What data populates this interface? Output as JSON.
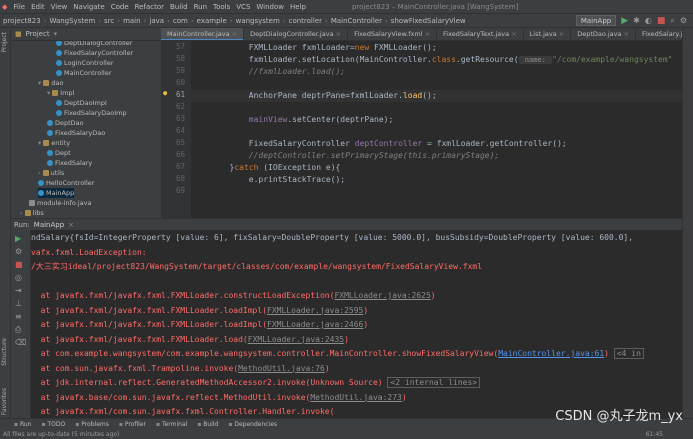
{
  "menubar": {
    "items": [
      "File",
      "Edit",
      "View",
      "Navigate",
      "Code",
      "Refactor",
      "Build",
      "Run",
      "Tools",
      "VCS",
      "Window",
      "Help"
    ],
    "title": "project823 – MainController.java [WangSystem]"
  },
  "navbar": {
    "crumbs": [
      "project823",
      "WangSystem",
      "src",
      "main",
      "java",
      "com",
      "example",
      "wangsystem",
      "controller",
      "MainController",
      "showFixedSalaryView"
    ],
    "run_config": "MainApp"
  },
  "left_strip": {
    "project": "Project",
    "structure": "Structure",
    "favorites": "Favorites"
  },
  "project_panel": {
    "title": "Project"
  },
  "tree": [
    {
      "label": "DeptDialogController",
      "icon": "class",
      "depth": 3
    },
    {
      "label": "FixedSalaryController",
      "icon": "class",
      "depth": 3
    },
    {
      "label": "LoginController",
      "icon": "class",
      "depth": 3
    },
    {
      "label": "MainController",
      "icon": "class",
      "depth": 3
    },
    {
      "label": "dao",
      "icon": "folder",
      "depth": 1,
      "expanded": true
    },
    {
      "label": "impl",
      "icon": "folder",
      "depth": 2,
      "expanded": true
    },
    {
      "label": "DeptDaoImpl",
      "icon": "class",
      "depth": 3
    },
    {
      "label": "FixedSalaryDaoImp",
      "icon": "class",
      "depth": 3
    },
    {
      "label": "DeptDao",
      "icon": "class",
      "depth": 2
    },
    {
      "label": "FixedSalaryDao",
      "icon": "class",
      "depth": 2
    },
    {
      "label": "entity",
      "icon": "folder",
      "depth": 1,
      "expanded": true
    },
    {
      "label": "Dept",
      "icon": "class",
      "depth": 2
    },
    {
      "label": "FixedSalary",
      "icon": "class",
      "depth": 2
    },
    {
      "label": "utils",
      "icon": "folder",
      "depth": 1,
      "expanded": false
    },
    {
      "label": "HelloController",
      "icon": "class",
      "depth": 1
    },
    {
      "label": "MainApp",
      "icon": "class",
      "depth": 1
    },
    {
      "label": "module-info.java",
      "icon": "java",
      "depth": 0
    },
    {
      "label": "libs",
      "icon": "folder",
      "depth": -1,
      "expanded": false
    }
  ],
  "tabs": [
    "MainController.java",
    "DeptDialogController.java",
    "FixedSalaryView.fxml",
    "FixedSalaryText.java",
    "List.java",
    "DeptDao.java",
    "FixedSalary.java"
  ],
  "gutter": [
    "57",
    "58",
    "59",
    "60",
    "61",
    "62",
    "63",
    "64",
    "65",
    "66",
    "67",
    "68",
    "69"
  ],
  "code": [
    {
      "indent": "            ",
      "parts": [
        [
          "FXMLLoader fxmlLoader=",
          "df"
        ],
        [
          "new ",
          "kw"
        ],
        [
          "FXMLLoader();",
          "df"
        ]
      ]
    },
    {
      "indent": "            ",
      "parts": [
        [
          "fxmlLoader.setLocation(MainController.",
          "df"
        ],
        [
          "class",
          "kw"
        ],
        [
          ".getResource(",
          "df"
        ],
        [
          " name: ",
          "hint"
        ],
        [
          "\"/com/example/wangsystem\"",
          "st"
        ]
      ]
    },
    {
      "indent": "            ",
      "parts": [
        [
          "//fxmlLoader.load();",
          "cm"
        ]
      ]
    },
    {
      "indent": "",
      "parts": []
    },
    {
      "indent": "            ",
      "parts": [
        [
          "AnchorPane ",
          "df"
        ],
        [
          "deptrPane",
          "df"
        ],
        [
          "=fxmlLoader.",
          "df"
        ],
        [
          "load",
          "mt"
        ],
        [
          "();",
          "df"
        ]
      ]
    },
    {
      "indent": "",
      "parts": []
    },
    {
      "indent": "            ",
      "parts": [
        [
          "mainView",
          "fd"
        ],
        [
          ".setCenter(deptrPane);",
          "df"
        ]
      ]
    },
    {
      "indent": "",
      "parts": []
    },
    {
      "indent": "            ",
      "parts": [
        [
          "FixedSalaryController ",
          "df"
        ],
        [
          "deptController",
          "fd"
        ],
        [
          " = fxmlLoader.getController();",
          "df"
        ]
      ]
    },
    {
      "indent": "            ",
      "parts": [
        [
          "//deptController.setPrimaryStage(this.primaryStage);",
          "cm"
        ]
      ]
    },
    {
      "indent": "        ",
      "parts": [
        [
          "}",
          "df"
        ],
        [
          "catch ",
          "kw"
        ],
        [
          "(IOException e){",
          "df"
        ]
      ]
    },
    {
      "indent": "            ",
      "parts": [
        [
          "e.printStackTrace();",
          "df"
        ]
      ]
    },
    {
      "indent": "",
      "parts": []
    }
  ],
  "run_panel": {
    "label": "Run:",
    "config": "MainApp"
  },
  "console": [
    {
      "parts": [
        [
          "ndSalary{fsId=IntegerProperty [value: 6], fixSalary=DoubleProperty [value: 5000.0], busSubsidy=DoubleProperty [value: 600.0],",
          "df"
        ]
      ]
    },
    {
      "parts": [
        [
          "vafx.fxml.LoadException:",
          "er"
        ]
      ]
    },
    {
      "parts": [
        [
          "/大三实习ideal/project823/WangSystem/target/classes/com/example/wangsystem/FixedSalaryView.fxml",
          "er"
        ]
      ]
    },
    {
      "parts": []
    },
    {
      "parts": [
        [
          "  at javafx.fxml/javafx.fxml.FXMLLoader.constructLoadException(",
          "er"
        ],
        [
          "FXMLLoader.java:2625",
          "lk2"
        ],
        [
          ")",
          "er"
        ]
      ]
    },
    {
      "parts": [
        [
          "  at javafx.fxml/javafx.fxml.FXMLLoader.loadImpl(",
          "er"
        ],
        [
          "FXMLLoader.java:2595",
          "lk2"
        ],
        [
          ")",
          "er"
        ]
      ]
    },
    {
      "parts": [
        [
          "  at javafx.fxml/javafx.fxml.FXMLLoader.loadImpl(",
          "er"
        ],
        [
          "FXMLLoader.java:2466",
          "lk2"
        ],
        [
          ")",
          "er"
        ]
      ]
    },
    {
      "parts": [
        [
          "  at javafx.fxml/javafx.fxml.FXMLLoader.load(",
          "er"
        ],
        [
          "FXMLLoader.java:2435",
          "lk2"
        ],
        [
          ")",
          "er"
        ]
      ]
    },
    {
      "parts": [
        [
          "  at com.example.wangsystem/com.example.wangsystem.controller.MainController.showFixedSalaryView(",
          "er"
        ],
        [
          "MainController.java:61",
          "lk"
        ],
        [
          ") ",
          "er"
        ],
        [
          "<4 in",
          "box"
        ]
      ]
    },
    {
      "parts": [
        [
          "  at com.sun.javafx.fxml.Trampoline.invoke(",
          "er"
        ],
        [
          "MethodUtil.java:76",
          "lk2"
        ],
        [
          ")",
          "er"
        ]
      ]
    },
    {
      "parts": [
        [
          "  at jdk.internal.reflect.GeneratedMethodAccessor2.invoke(Unknown Source) ",
          "er"
        ],
        [
          "<2 internal lines>",
          "box"
        ]
      ]
    },
    {
      "parts": [
        [
          "  at javafx.base/com.sun.javafx.reflect.MethodUtil.invoke(",
          "er"
        ],
        [
          "MethodUtil.java:273",
          "lk2"
        ],
        [
          ")",
          "er"
        ]
      ]
    },
    {
      "parts": [
        [
          "  at javafx.fxml/com.sun.javafx.fxml.Controller.Handler.invoke(",
          "er"
        ]
      ]
    }
  ],
  "bottom_tabs": [
    "Run",
    "TODO",
    "Problems",
    "Profiler",
    "Terminal",
    "Build",
    "Dependencies"
  ],
  "status": {
    "left": "All files are up-to-date (5 minutes ago)",
    "right": "61:45"
  },
  "watermark": "CSDN @丸子龙m_yx",
  "colors": {
    "error": "#ff6b68",
    "link": "#5394ec",
    "keyword": "#cc7832",
    "method": "#ffc66d"
  }
}
